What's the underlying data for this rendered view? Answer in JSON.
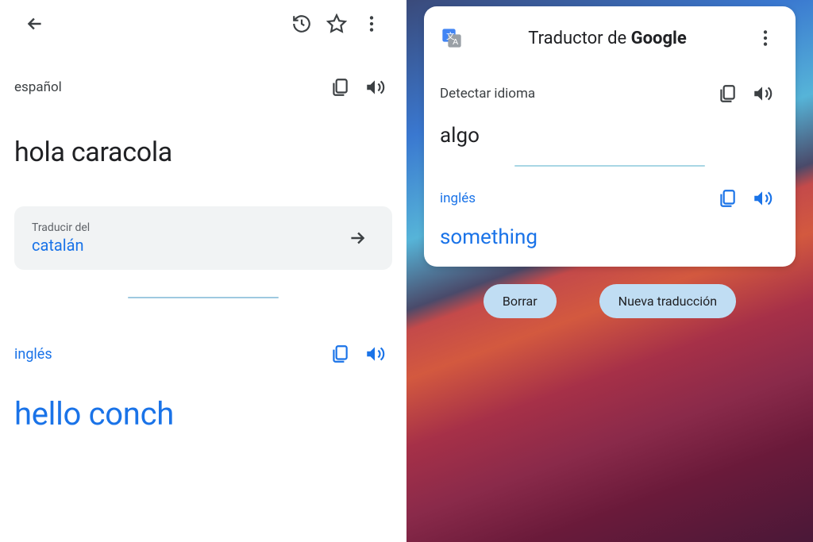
{
  "left": {
    "source_lang": "español",
    "source_text": "hola caracola",
    "detect_label": "Traducir del",
    "detect_lang": "catalán",
    "out_lang": "inglés",
    "out_text": "hello conch"
  },
  "right": {
    "title_prefix": "Traductor de ",
    "title_brand": "Google",
    "source_lang": "Detectar idioma",
    "source_text": "algo",
    "out_lang": "inglés",
    "out_text": "something",
    "clear_label": "Borrar",
    "new_label": "Nueva traducción"
  }
}
